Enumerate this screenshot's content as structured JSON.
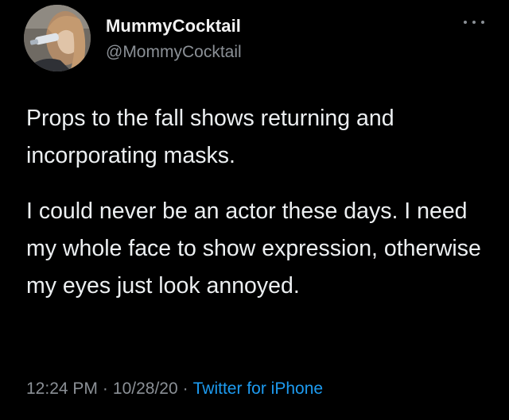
{
  "user": {
    "display_name": "MummyCocktail",
    "handle": "@MommyCocktail",
    "avatar_icon": "profile-photo-avatar"
  },
  "menu": {
    "icon": "more-options-icon"
  },
  "tweet": {
    "paragraph_1": "Props to the fall shows returning and incorporating masks.",
    "paragraph_2": "I could never be an actor these days. I need my whole face to show expression, otherwise my eyes just look annoyed."
  },
  "meta": {
    "time": "12:24 PM",
    "date": "10/28/20",
    "separator": "·",
    "source": "Twitter for iPhone"
  },
  "colors": {
    "background": "#000000",
    "text": "#eceff1",
    "secondary": "#8b9096",
    "link": "#1d9bf0"
  }
}
